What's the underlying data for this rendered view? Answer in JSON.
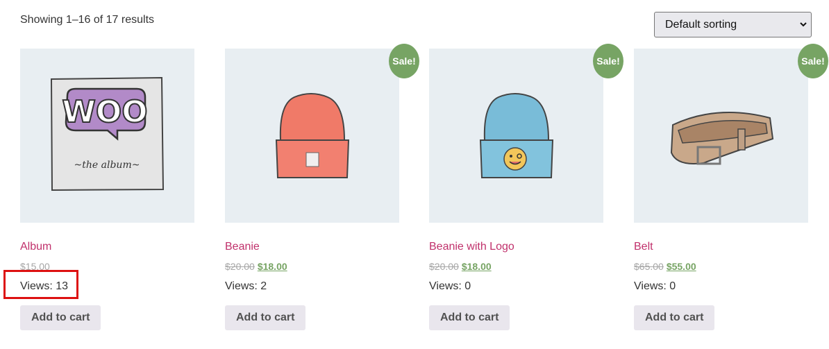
{
  "toolbar": {
    "result_count": "Showing 1–16 of 17 results",
    "sorting_selected": "Default sorting"
  },
  "colors": {
    "sale_badge": "#77a464",
    "product_title": "#c0306b",
    "highlight_box": "#dd1111"
  },
  "products": [
    {
      "title": "Album",
      "sale_badge": "",
      "price_regular": "$15.00",
      "views": "Views: 13",
      "add_to_cart": "Add to cart",
      "image_icon": "album-woo-icon"
    },
    {
      "title": "Beanie",
      "sale_badge": "Sale!",
      "price_old": "$20.00",
      "price_new": "$18.00",
      "views": "Views: 2",
      "add_to_cart": "Add to cart",
      "image_icon": "beanie-icon"
    },
    {
      "title": "Beanie with Logo",
      "sale_badge": "Sale!",
      "price_old": "$20.00",
      "price_new": "$18.00",
      "views": "Views: 0",
      "add_to_cart": "Add to cart",
      "image_icon": "beanie-logo-icon"
    },
    {
      "title": "Belt",
      "sale_badge": "Sale!",
      "price_old": "$65.00",
      "price_new": "$55.00",
      "views": "Views: 0",
      "add_to_cart": "Add to cart",
      "image_icon": "belt-icon"
    }
  ],
  "album_art": {
    "logo_text": "WOO",
    "caption": "~the album~"
  }
}
